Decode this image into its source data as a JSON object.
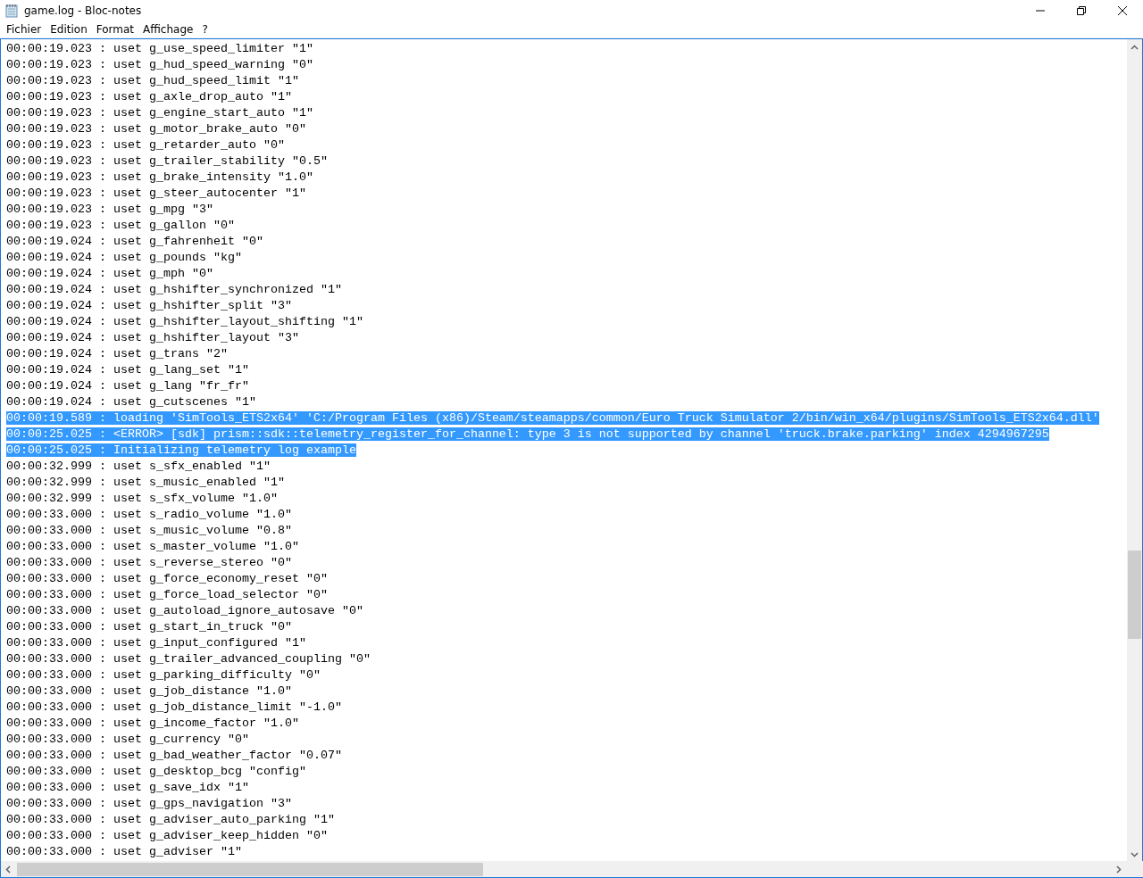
{
  "window": {
    "title": "game.log - Bloc-notes"
  },
  "menu": [
    "Fichier",
    "Edition",
    "Format",
    "Affichage",
    "?"
  ],
  "lines": [
    {
      "text": "00:00:19.023 : uset g_use_speed_limiter \"1\"",
      "selected": false
    },
    {
      "text": "00:00:19.023 : uset g_hud_speed_warning \"0\"",
      "selected": false
    },
    {
      "text": "00:00:19.023 : uset g_hud_speed_limit \"1\"",
      "selected": false
    },
    {
      "text": "00:00:19.023 : uset g_axle_drop_auto \"1\"",
      "selected": false
    },
    {
      "text": "00:00:19.023 : uset g_engine_start_auto \"1\"",
      "selected": false
    },
    {
      "text": "00:00:19.023 : uset g_motor_brake_auto \"0\"",
      "selected": false
    },
    {
      "text": "00:00:19.023 : uset g_retarder_auto \"0\"",
      "selected": false
    },
    {
      "text": "00:00:19.023 : uset g_trailer_stability \"0.5\"",
      "selected": false
    },
    {
      "text": "00:00:19.023 : uset g_brake_intensity \"1.0\"",
      "selected": false
    },
    {
      "text": "00:00:19.023 : uset g_steer_autocenter \"1\"",
      "selected": false
    },
    {
      "text": "00:00:19.023 : uset g_mpg \"3\"",
      "selected": false
    },
    {
      "text": "00:00:19.023 : uset g_gallon \"0\"",
      "selected": false
    },
    {
      "text": "00:00:19.024 : uset g_fahrenheit \"0\"",
      "selected": false
    },
    {
      "text": "00:00:19.024 : uset g_pounds \"kg\"",
      "selected": false
    },
    {
      "text": "00:00:19.024 : uset g_mph \"0\"",
      "selected": false
    },
    {
      "text": "00:00:19.024 : uset g_hshifter_synchronized \"1\"",
      "selected": false
    },
    {
      "text": "00:00:19.024 : uset g_hshifter_split \"3\"",
      "selected": false
    },
    {
      "text": "00:00:19.024 : uset g_hshifter_layout_shifting \"1\"",
      "selected": false
    },
    {
      "text": "00:00:19.024 : uset g_hshifter_layout \"3\"",
      "selected": false
    },
    {
      "text": "00:00:19.024 : uset g_trans \"2\"",
      "selected": false
    },
    {
      "text": "00:00:19.024 : uset g_lang_set \"1\"",
      "selected": false
    },
    {
      "text": "00:00:19.024 : uset g_lang \"fr_fr\"",
      "selected": false
    },
    {
      "text": "00:00:19.024 : uset g_cutscenes \"1\"",
      "selected": false
    },
    {
      "text": "00:00:19.589 : loading 'SimTools_ETS2x64' 'C:/Program Files (x86)/Steam/steamapps/common/Euro Truck Simulator 2/bin/win_x64/plugins/SimTools_ETS2x64.dll'",
      "selected": true
    },
    {
      "text": "00:00:25.025 : <ERROR> [sdk] prism::sdk::telemetry_register_for_channel: type 3 is not supported by channel 'truck.brake.parking' index 4294967295",
      "selected": true
    },
    {
      "text": "00:00:25.025 : Initializing telemetry log example",
      "selected": true
    },
    {
      "text": "00:00:32.999 : uset s_sfx_enabled \"1\"",
      "selected": false
    },
    {
      "text": "00:00:32.999 : uset s_music_enabled \"1\"",
      "selected": false
    },
    {
      "text": "00:00:32.999 : uset s_sfx_volume \"1.0\"",
      "selected": false
    },
    {
      "text": "00:00:33.000 : uset s_radio_volume \"1.0\"",
      "selected": false
    },
    {
      "text": "00:00:33.000 : uset s_music_volume \"0.8\"",
      "selected": false
    },
    {
      "text": "00:00:33.000 : uset s_master_volume \"1.0\"",
      "selected": false
    },
    {
      "text": "00:00:33.000 : uset s_reverse_stereo \"0\"",
      "selected": false
    },
    {
      "text": "00:00:33.000 : uset g_force_economy_reset \"0\"",
      "selected": false
    },
    {
      "text": "00:00:33.000 : uset g_force_load_selector \"0\"",
      "selected": false
    },
    {
      "text": "00:00:33.000 : uset g_autoload_ignore_autosave \"0\"",
      "selected": false
    },
    {
      "text": "00:00:33.000 : uset g_start_in_truck \"0\"",
      "selected": false
    },
    {
      "text": "00:00:33.000 : uset g_input_configured \"1\"",
      "selected": false
    },
    {
      "text": "00:00:33.000 : uset g_trailer_advanced_coupling \"0\"",
      "selected": false
    },
    {
      "text": "00:00:33.000 : uset g_parking_difficulty \"0\"",
      "selected": false
    },
    {
      "text": "00:00:33.000 : uset g_job_distance \"1.0\"",
      "selected": false
    },
    {
      "text": "00:00:33.000 : uset g_job_distance_limit \"-1.0\"",
      "selected": false
    },
    {
      "text": "00:00:33.000 : uset g_income_factor \"1.0\"",
      "selected": false
    },
    {
      "text": "00:00:33.000 : uset g_currency \"0\"",
      "selected": false
    },
    {
      "text": "00:00:33.000 : uset g_bad_weather_factor \"0.07\"",
      "selected": false
    },
    {
      "text": "00:00:33.000 : uset g_desktop_bcg \"config\"",
      "selected": false
    },
    {
      "text": "00:00:33.000 : uset g_save_idx \"1\"",
      "selected": false
    },
    {
      "text": "00:00:33.000 : uset g_gps_navigation \"3\"",
      "selected": false
    },
    {
      "text": "00:00:33.000 : uset g_adviser_auto_parking \"1\"",
      "selected": false
    },
    {
      "text": "00:00:33.000 : uset g_adviser_keep_hidden \"0\"",
      "selected": false
    },
    {
      "text": "00:00:33.000 : uset g_adviser \"1\"",
      "selected": false
    }
  ]
}
